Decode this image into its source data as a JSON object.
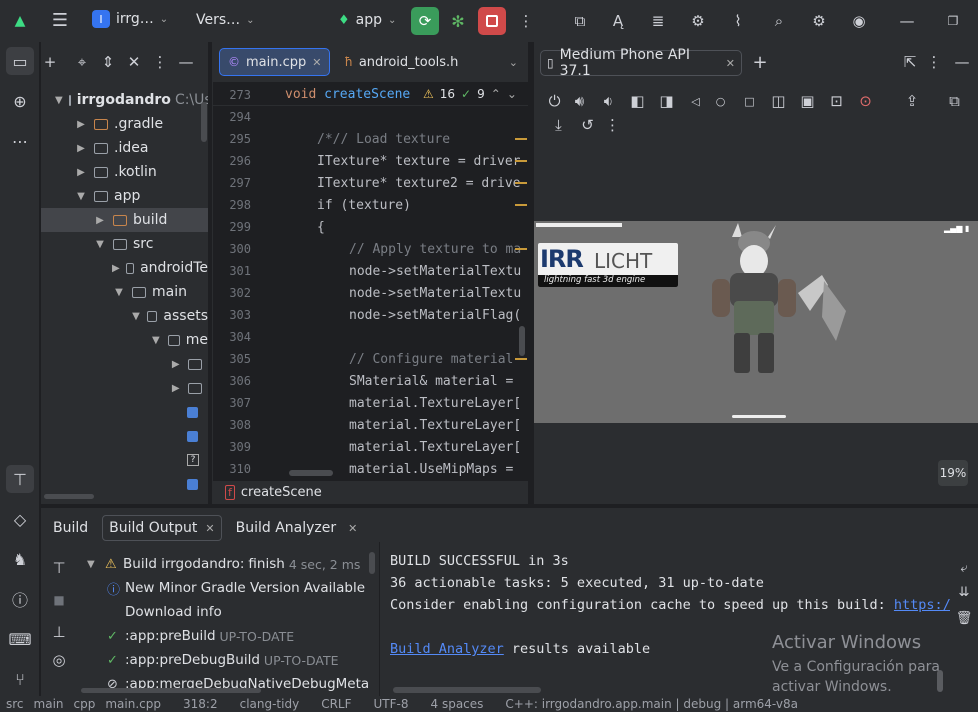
{
  "titlebar": {
    "project_badge": "I",
    "project_name": "irrg…",
    "vcs": "Vers…",
    "run_config": "app",
    "colors": {
      "run": "#3a9c5b",
      "stop": "#d04a4a",
      "accent": "#3574f0"
    }
  },
  "project_tree": {
    "root_name": "irrgodandro",
    "root_path": "C:\\Us",
    "items": [
      {
        "label": ".gradle",
        "indent": 1,
        "expanded": false,
        "icon": "folder-orange"
      },
      {
        "label": ".idea",
        "indent": 1,
        "expanded": false,
        "icon": "folder"
      },
      {
        "label": ".kotlin",
        "indent": 1,
        "expanded": false,
        "icon": "folder"
      },
      {
        "label": "app",
        "indent": 1,
        "expanded": true,
        "icon": "module"
      },
      {
        "label": "build",
        "indent": 2,
        "expanded": false,
        "icon": "folder-orange",
        "selected": true
      },
      {
        "label": "src",
        "indent": 2,
        "expanded": true,
        "icon": "folder"
      },
      {
        "label": "androidTe",
        "indent": 3,
        "expanded": false,
        "icon": "folder"
      },
      {
        "label": "main",
        "indent": 3,
        "expanded": true,
        "icon": "folder"
      },
      {
        "label": "assets",
        "indent": 4,
        "expanded": true,
        "icon": "folder"
      },
      {
        "label": "me",
        "indent": 5,
        "expanded": true,
        "icon": "folder"
      },
      {
        "label": "",
        "indent": 6,
        "expanded": false,
        "icon": "folder"
      },
      {
        "label": "",
        "indent": 6,
        "expanded": false,
        "icon": "folder"
      },
      {
        "label": "",
        "indent": 6,
        "expanded": null,
        "icon": "image-file"
      },
      {
        "label": "",
        "indent": 6,
        "expanded": null,
        "icon": "image-file"
      },
      {
        "label": "?",
        "indent": 6,
        "expanded": null,
        "icon": "unknown-file"
      },
      {
        "label": "",
        "indent": 6,
        "expanded": null,
        "icon": "image-file"
      }
    ]
  },
  "editor": {
    "tab_active": "main.cpp",
    "tab_other": "android_tools.h",
    "sticky_line": "273",
    "sticky_code_kw": "void",
    "sticky_code_fn": "createScene",
    "warnings": "16",
    "checks": "9",
    "breadcrumb": "createScene",
    "lines": [
      {
        "n": "294",
        "code": ""
      },
      {
        "n": "295",
        "code": "/*// Load texture",
        "indent": 1,
        "comment": true
      },
      {
        "n": "296",
        "code": "ITexture* texture = driver",
        "indent": 1
      },
      {
        "n": "297",
        "code": "ITexture* texture2 = drive",
        "indent": 1
      },
      {
        "n": "298",
        "code": "if (texture)",
        "indent": 1
      },
      {
        "n": "299",
        "code": "{",
        "indent": 1
      },
      {
        "n": "300",
        "code": "// Apply texture to ma",
        "indent": 2,
        "comment": true
      },
      {
        "n": "301",
        "code": "node->setMaterialTextu",
        "indent": 2
      },
      {
        "n": "302",
        "code": "node->setMaterialTextu",
        "indent": 2
      },
      {
        "n": "303",
        "code": "node->setMaterialFlag(",
        "indent": 2
      },
      {
        "n": "304",
        "code": ""
      },
      {
        "n": "305",
        "code": "// Configure material",
        "indent": 2,
        "comment": true
      },
      {
        "n": "306",
        "code": "SMaterial& material =",
        "indent": 2
      },
      {
        "n": "307",
        "code": "material.TextureLayer[",
        "indent": 2
      },
      {
        "n": "308",
        "code": "material.TextureLayer[",
        "indent": 2
      },
      {
        "n": "309",
        "code": "material.TextureLayer[",
        "indent": 2
      },
      {
        "n": "310",
        "code": "material.UseMipMaps =",
        "indent": 2
      }
    ]
  },
  "emulator": {
    "device": "Medium Phone API 37.1",
    "zoom": "19%",
    "logo_main": "IRR",
    "logo_sub": "LICHT",
    "logo_tagline": "lightning fast 3d engine"
  },
  "build": {
    "tab_label": "Build",
    "tab_output": "Build Output",
    "tab_analyzer": "Build Analyzer",
    "tree": [
      {
        "label": "Build irrgodandro:",
        "bold_suffix": "finish",
        "meta": "4 sec, 2 ms",
        "icon": "warning-icon"
      },
      {
        "label": "New Minor Gradle Version Available",
        "icon": "info-icon"
      },
      {
        "label": "Download info",
        "icon": "download-icon"
      },
      {
        "label": ":app:preBuild",
        "meta": "UP-TO-DATE",
        "icon": "check-icon"
      },
      {
        "label": ":app:preDebugBuild",
        "meta": "UP-TO-DATE",
        "icon": "check-icon"
      },
      {
        "label": ":app:mergeDebugNativeDebugMeta",
        "icon": "skip-icon"
      }
    ],
    "output": {
      "line1": "BUILD SUCCESSFUL in 3s",
      "line2": "36 actionable tasks: 5 executed, 31 up-to-date",
      "line3": "Consider enabling configuration cache to speed up this build: ",
      "line3_link": "https:/",
      "line5_link": "Build Analyzer",
      "line5_rest": " results available"
    },
    "watermark_title": "Activar Windows",
    "watermark_sub": "Ve a Configuración para activar Windows."
  },
  "statusbar": {
    "items": [
      "src",
      "main",
      "cpp",
      "main.cpp",
      "318:2",
      "clang-tidy",
      "CRLF",
      "UTF-8",
      "4 spaces",
      "C++: irrgodandro.app.main | debug | arm64-v8a"
    ]
  }
}
